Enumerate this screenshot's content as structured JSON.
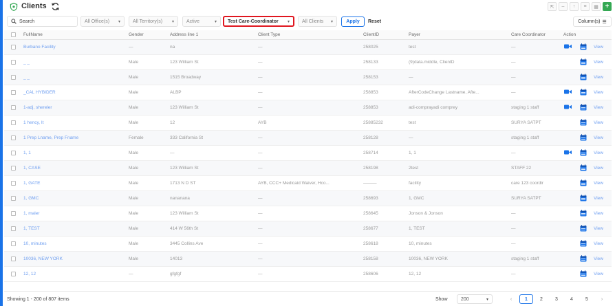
{
  "header": {
    "title": "Clients",
    "top_icons": [
      "collapse-icon",
      "minimize-icon",
      "upload-icon",
      "list-icon",
      "grid-icon",
      "add-icon"
    ],
    "add_label": "+"
  },
  "filters": {
    "search_placeholder": "Search",
    "office": "All Office(s)",
    "territory": "All Territory(s)",
    "status": "Active",
    "care_coordinator": "Test Care-Coordinator",
    "clients": "All Clients",
    "apply_label": "Apply",
    "reset_label": "Reset",
    "columns_label": "Column(s)"
  },
  "table": {
    "columns": [
      "FullName",
      "Gender",
      "Address line 1",
      "Client Type",
      "ClientID",
      "Payer",
      "Care Coordinator",
      "Action"
    ],
    "rows": [
      {
        "name": "Burbano Facility",
        "gender": "—",
        "address": "na",
        "type": "—",
        "id": "258025",
        "payer": "test",
        "coordinator": "—",
        "video": true
      },
      {
        "name": "_ _",
        "gender": "Male",
        "address": "123 William St",
        "type": "—",
        "id": "258133",
        "payer": "(9)data.middle, ClientD",
        "coordinator": "—",
        "video": false
      },
      {
        "name": "_ _",
        "gender": "Male",
        "address": "1515 Broadway",
        "type": "—",
        "id": "258153",
        "payer": "—",
        "coordinator": "—",
        "video": false
      },
      {
        "name": "_CAL HYBIDER",
        "gender": "Male",
        "address": "ALBP",
        "type": "—",
        "id": "258853",
        "payer": "AfterCodeChange Lastname, Afte...",
        "coordinator": "—",
        "video": true
      },
      {
        "name": "1-adj, shereler",
        "gender": "Male",
        "address": "123 William St",
        "type": "—",
        "id": "258853",
        "payer": "adi-comprayadi comprey",
        "coordinator": "staging 1 staff",
        "video": true
      },
      {
        "name": "1 hency, It",
        "gender": "Male",
        "address": "12",
        "type": "AYB",
        "id": "25885232",
        "payer": "test",
        "coordinator": "SURYA SATPT",
        "video": false
      },
      {
        "name": "1 Prep Lname, Prep Fname",
        "gender": "Female",
        "address": "333 California St",
        "type": "—",
        "id": "258128",
        "payer": "—",
        "coordinator": "staging 1 staff",
        "video": false
      },
      {
        "name": "1, 1",
        "gender": "Male",
        "address": "—",
        "type": "—",
        "id": "258714",
        "payer": "1, 1",
        "coordinator": "—",
        "video": true
      },
      {
        "name": "1, CASE",
        "gender": "Male",
        "address": "123 William St",
        "type": "—",
        "id": "258198",
        "payer": "2test",
        "coordinator": "STAFF 22",
        "video": false
      },
      {
        "name": "1, GATE",
        "gender": "Male",
        "address": "1713 N D ST",
        "type": "AYB, CCC+ Medicaid Waiver, Hco...",
        "id": "———",
        "payer": "facility",
        "coordinator": "care 123 coordir",
        "video": false
      },
      {
        "name": "1, GMC",
        "gender": "Male",
        "address": "nananana",
        "type": "—",
        "id": "258693",
        "payer": "1, GMC",
        "coordinator": "SURYA SATPT",
        "video": false
      },
      {
        "name": "1, maler",
        "gender": "Male",
        "address": "123 William St",
        "type": "—",
        "id": "258645",
        "payer": "Jonson & Jonson",
        "coordinator": "—",
        "video": false
      },
      {
        "name": "1, TEST",
        "gender": "Male",
        "address": "414 W 56th St",
        "type": "—",
        "id": "258677",
        "payer": "1, TEST",
        "coordinator": "—",
        "video": false
      },
      {
        "name": "10, minutes",
        "gender": "Male",
        "address": "3445 Collins Ave",
        "type": "—",
        "id": "258618",
        "payer": "10, minutes",
        "coordinator": "—",
        "video": false
      },
      {
        "name": "10036, NEW YORK",
        "gender": "Male",
        "address": "14013",
        "type": "—",
        "id": "258158",
        "payer": "10036, NEW YORK",
        "coordinator": "staging 1 staff",
        "video": false
      },
      {
        "name": "12, 12",
        "gender": "—",
        "address": "gfgfgf",
        "type": "—",
        "id": "258606",
        "payer": "12, 12",
        "coordinator": "—",
        "video": false
      }
    ],
    "view_label": "View"
  },
  "footer": {
    "showing": "Showing 1 - 200 of 807 items",
    "show_label": "Show",
    "per_page": "200",
    "pages": [
      "1",
      "2",
      "3",
      "4",
      "5"
    ],
    "active_page": "1",
    "prev": "‹",
    "next": "›"
  },
  "colors": {
    "accent": "#1a73e8",
    "link": "#6e9ef0",
    "highlight_border": "#e0161f",
    "add_button": "#34a853"
  }
}
